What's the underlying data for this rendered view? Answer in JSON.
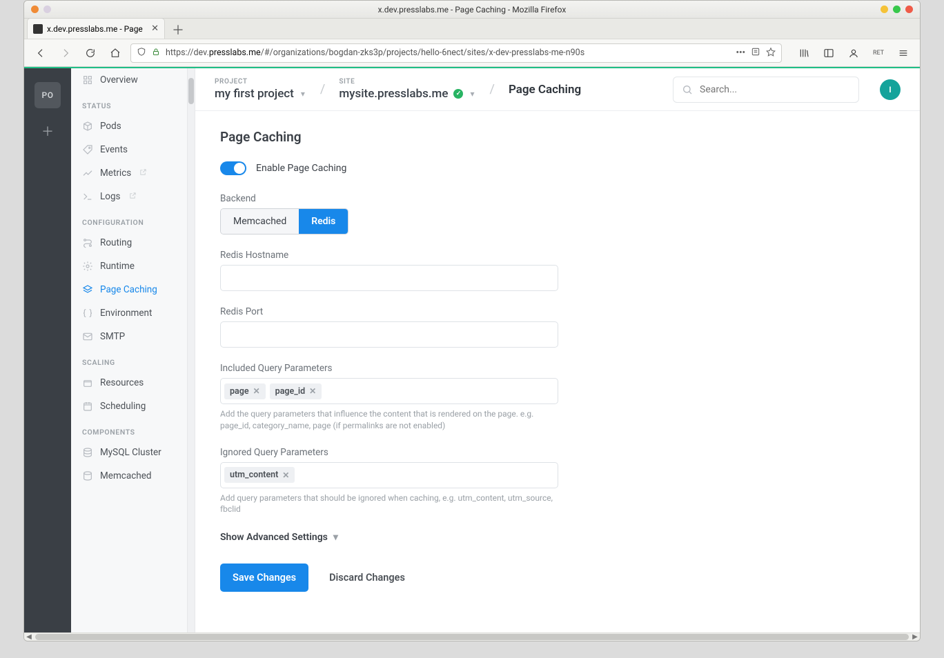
{
  "window": {
    "title": "x.dev.presslabs.me - Page Caching - Mozilla Firefox"
  },
  "browser": {
    "tab_label": "x.dev.presslabs.me - Page",
    "url": {
      "prefix": "https://dev.",
      "domain": "presslabs.me",
      "suffix": "/#/organizations/bogdan-zks3p/projects/hello-6nect/sites/x-dev-presslabs-me-n90s"
    }
  },
  "rail": {
    "org_initials": "PO"
  },
  "breadcrumb": {
    "project_label": "PROJECT",
    "project_name": "my first project",
    "site_label": "SITE",
    "site_name": "mysite.presslabs.me",
    "leaf": "Page Caching"
  },
  "search": {
    "placeholder": "Search..."
  },
  "avatar": {
    "initial": "I"
  },
  "sidebar": {
    "overview": "Overview",
    "groups": [
      {
        "title": "STATUS",
        "items": [
          "Pods",
          "Events",
          "Metrics",
          "Logs"
        ]
      },
      {
        "title": "CONFIGURATION",
        "items": [
          "Routing",
          "Runtime",
          "Page Caching",
          "Environment",
          "SMTP"
        ]
      },
      {
        "title": "SCALING",
        "items": [
          "Resources",
          "Scheduling"
        ]
      },
      {
        "title": "COMPONENTS",
        "items": [
          "MySQL Cluster",
          "Memcached"
        ]
      }
    ]
  },
  "page": {
    "title": "Page Caching",
    "enable_label": "Enable Page Caching",
    "enable_value": true,
    "backend": {
      "label": "Backend",
      "options": [
        "Memcached",
        "Redis"
      ],
      "selected": "Redis"
    },
    "redis_host": {
      "label": "Redis Hostname",
      "value": ""
    },
    "redis_port": {
      "label": "Redis Port",
      "value": ""
    },
    "included": {
      "label": "Included Query Parameters",
      "tags": [
        "page",
        "page_id"
      ],
      "help": "Add the query parameters that influence the content that is rendered on the page. e.g. page_id, category_name, page (if permalinks are not enabled)"
    },
    "ignored": {
      "label": "Ignored Query Parameters",
      "tags": [
        "utm_content"
      ],
      "help": "Add query parameters that should be ignored when caching, e.g. utm_content, utm_source, fbclid"
    },
    "advanced": "Show Advanced Settings",
    "save": "Save Changes",
    "discard": "Discard Changes"
  }
}
